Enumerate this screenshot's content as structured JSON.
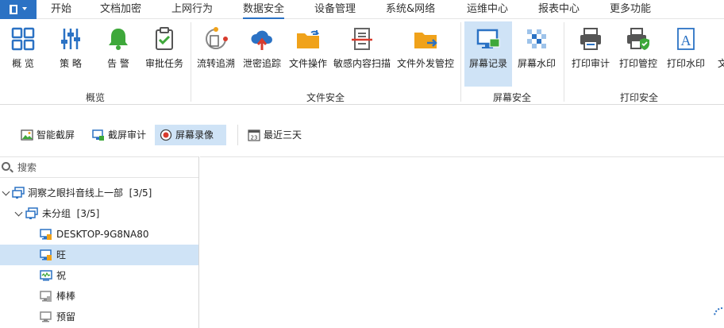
{
  "menu": {
    "items": [
      "开始",
      "文档加密",
      "上网行为",
      "数据安全",
      "设备管理",
      "系统&网络",
      "运维中心",
      "报表中心",
      "更多功能"
    ],
    "active_index": 3
  },
  "ribbon": {
    "buttons": [
      {
        "label": "概 览",
        "icon": "grid-icon"
      },
      {
        "label": "策 略",
        "icon": "sliders-icon"
      },
      {
        "label": "告 警",
        "icon": "bell-icon"
      },
      {
        "label": "审批任务",
        "icon": "clipboard-check-icon"
      },
      {
        "label": "流转追溯",
        "icon": "trace-flow-icon"
      },
      {
        "label": "泄密追踪",
        "icon": "cloud-upload-icon"
      },
      {
        "label": "文件操作",
        "icon": "folder-arrow-icon"
      },
      {
        "label": "敏感内容扫描",
        "icon": "document-scan-icon"
      },
      {
        "label": "文件外发管控",
        "icon": "folder-send-icon"
      },
      {
        "label": "屏幕记录",
        "icon": "monitor-image-icon"
      },
      {
        "label": "屏幕水印",
        "icon": "watermark-icon"
      },
      {
        "label": "打印审计",
        "icon": "printer-icon"
      },
      {
        "label": "打印管控",
        "icon": "printer-shield-icon"
      },
      {
        "label": "打印水印",
        "icon": "text-a-icon"
      },
      {
        "label": "文",
        "icon": "partial-icon"
      }
    ],
    "selected_index": 9,
    "groups": [
      "概览",
      "文件安全",
      "屏幕安全",
      "打印安全"
    ]
  },
  "subtoolbar": {
    "buttons": [
      {
        "label": "智能截屏",
        "icon": "image-icon"
      },
      {
        "label": "截屏审计",
        "icon": "screen-audit-icon"
      },
      {
        "label": "屏幕录像",
        "icon": "record-icon"
      },
      {
        "label": "最近三天",
        "icon": "calendar-icon"
      }
    ],
    "selected_index": 2,
    "calendar_day": "23"
  },
  "tree": {
    "search_placeholder": "搜索",
    "nodes": [
      {
        "label": "洞察之眼抖音线上一部",
        "count": "[3/5]",
        "level": 0,
        "expanded": true,
        "icon": "group-icon"
      },
      {
        "label": "未分组",
        "count": "[3/5]",
        "level": 1,
        "expanded": true,
        "icon": "group-icon"
      },
      {
        "label": "DESKTOP-9G8NA80",
        "count": "",
        "level": 2,
        "icon": "computer-online-icon"
      },
      {
        "label": "旺",
        "count": "",
        "level": 2,
        "icon": "computer-online-icon",
        "selected": true
      },
      {
        "label": "祝",
        "count": "",
        "level": 2,
        "icon": "computer-active-icon"
      },
      {
        "label": "棒棒",
        "count": "",
        "level": 2,
        "icon": "computer-offline-icon"
      },
      {
        "label": "预留",
        "count": "",
        "level": 2,
        "icon": "computer-offline-icon"
      }
    ]
  },
  "colors": {
    "accent": "#2b72c4",
    "selection": "#cfe3f6",
    "green": "#3ea83a",
    "orange": "#f0a21a",
    "red": "#d83b2d"
  }
}
